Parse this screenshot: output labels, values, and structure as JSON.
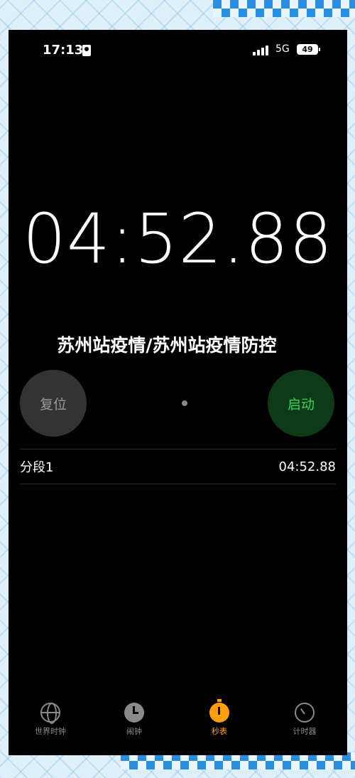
{
  "status_bar": {
    "time": "17:13",
    "network": "5G",
    "battery": "49"
  },
  "overlay_title": "苏州站疫情/苏州站疫情防控",
  "stopwatch": {
    "display_time": "04:52.88",
    "reset_label": "复位",
    "start_label": "启动"
  },
  "laps": [
    {
      "label": "分段1",
      "time": "04:52.88"
    }
  ],
  "tabs": [
    {
      "label": "世界时钟",
      "icon": "globe-icon"
    },
    {
      "label": "闹钟",
      "icon": "alarm-clock-icon"
    },
    {
      "label": "秒表",
      "icon": "stopwatch-icon",
      "active": true
    },
    {
      "label": "计时器",
      "icon": "timer-icon"
    }
  ],
  "colors": {
    "accent": "#ff9f0a",
    "start_green": "#33d35a",
    "background": "#000000"
  }
}
